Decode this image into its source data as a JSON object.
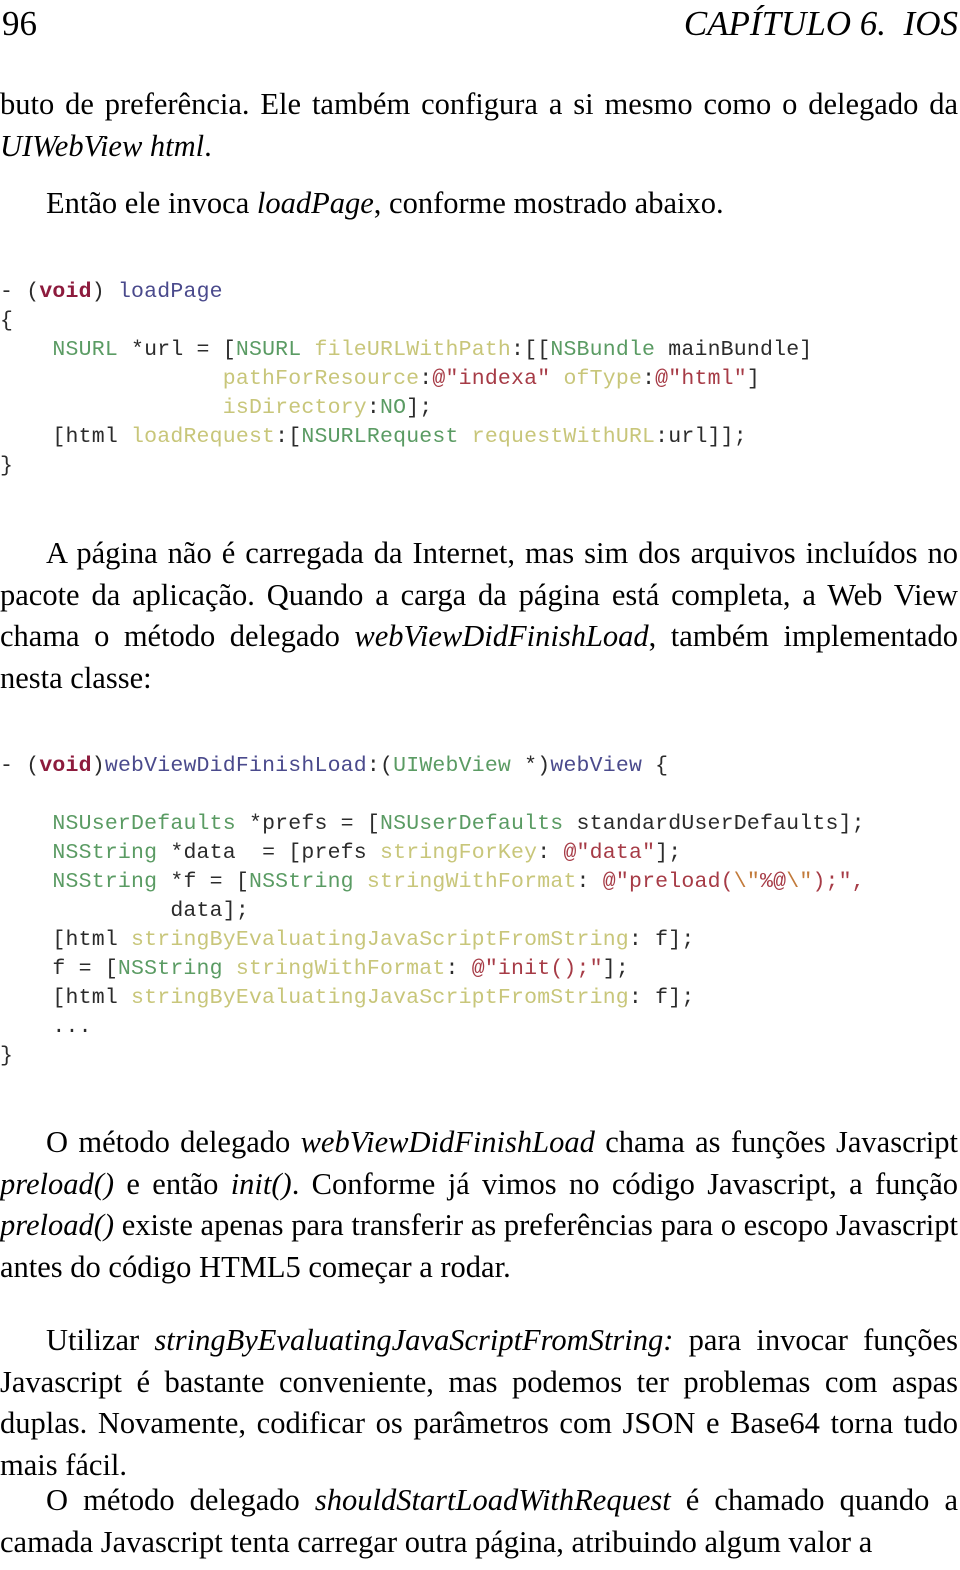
{
  "header": {
    "folio": "96",
    "chapter": "CAPÍTULO 6.  IOS"
  },
  "body": {
    "paragraph_1": {
      "line_1_a": "buto de preferência. Ele também configura a si mesmo como o delegado da ",
      "line_1_italic": "UIWebView html",
      "line_1_b": "."
    },
    "paragraph_2": {
      "a": "Então ele invoca ",
      "italic": "loadPage",
      "b": ", conforme mostrado abaixo."
    },
    "paragraph_3": {
      "a": "A página não é carregada da Internet, mas sim dos arquivos incluídos no pacote da aplicação. Quando a carga da página está completa, a Web View chama o método delegado ",
      "italic": "webViewDidFinishLoad",
      "b": ", também implementado nesta classe:"
    },
    "paragraph_4": {
      "a": "O método delegado ",
      "italic_1": "webViewDidFinishLoad",
      "b": " chama as funções Javascript ",
      "italic_2": "preload()",
      "c": " e então ",
      "italic_3": "init()",
      "d": ". Conforme já vimos no código Javascript, a função ",
      "italic_4": "preload()",
      "e": " existe apenas para transferir as preferências para o escopo Javascript antes do código HTML5 começar a rodar."
    },
    "paragraph_5": {
      "a": "Utilizar ",
      "italic": "stringByEvaluatingJavaScriptFromString:",
      "b": " para invocar funções Javascript é bastante conveniente, mas podemos ter problemas com aspas duplas. Novamente, codificar os parâmetros com JSON e Base64 torna tudo mais fácil."
    },
    "paragraph_6": {
      "a": "O método delegado ",
      "italic": "shouldStartLoadWithRequest",
      "b": " é chamado quando a camada Javascript tenta carregar outra página, atribuindo algum valor a"
    }
  },
  "code_blocks": [
    {
      "id": "loadPage",
      "lines": [
        [
          {
            "t": "- (",
            "c": "plain"
          },
          {
            "t": "void",
            "c": "type"
          },
          {
            "t": ") ",
            "c": "plain"
          },
          {
            "t": "loadPage",
            "c": "fn"
          }
        ],
        [
          {
            "t": "{",
            "c": "plain"
          }
        ],
        [
          {
            "t": "    ",
            "c": "plain"
          },
          {
            "t": "NSURL",
            "c": "class"
          },
          {
            "t": " *url = [",
            "c": "plain"
          },
          {
            "t": "NSURL",
            "c": "class"
          },
          {
            "t": " ",
            "c": "plain"
          },
          {
            "t": "fileURLWithPath",
            "c": "sel"
          },
          {
            "t": ":[[",
            "c": "plain"
          },
          {
            "t": "NSBundle",
            "c": "class"
          },
          {
            "t": " mainBundle]",
            "c": "plain"
          }
        ],
        [
          {
            "t": "                 ",
            "c": "plain"
          },
          {
            "t": "pathForResource",
            "c": "sel"
          },
          {
            "t": ":",
            "c": "plain"
          },
          {
            "t": "@\"indexa\"",
            "c": "str"
          },
          {
            "t": " ",
            "c": "plain"
          },
          {
            "t": "ofType",
            "c": "sel"
          },
          {
            "t": ":",
            "c": "plain"
          },
          {
            "t": "@\"html\"",
            "c": "str"
          },
          {
            "t": "]",
            "c": "plain"
          }
        ],
        [
          {
            "t": "                 ",
            "c": "plain"
          },
          {
            "t": "isDirectory",
            "c": "sel"
          },
          {
            "t": ":",
            "c": "plain"
          },
          {
            "t": "NO",
            "c": "class"
          },
          {
            "t": "];",
            "c": "plain"
          }
        ],
        [
          {
            "t": "    [html ",
            "c": "plain"
          },
          {
            "t": "loadRequest",
            "c": "sel"
          },
          {
            "t": ":[",
            "c": "plain"
          },
          {
            "t": "NSURLRequest",
            "c": "class"
          },
          {
            "t": " ",
            "c": "plain"
          },
          {
            "t": "requestWithURL",
            "c": "sel"
          },
          {
            "t": ":url]];",
            "c": "plain"
          }
        ],
        [
          {
            "t": "}",
            "c": "plain"
          }
        ]
      ]
    },
    {
      "id": "webViewDidFinishLoad",
      "lines": [
        [
          {
            "t": "- (",
            "c": "plain"
          },
          {
            "t": "void",
            "c": "type"
          },
          {
            "t": ")",
            "c": "plain"
          },
          {
            "t": "webViewDidFinishLoad",
            "c": "fn"
          },
          {
            "t": ":(",
            "c": "plain"
          },
          {
            "t": "UIWebView",
            "c": "class"
          },
          {
            "t": " *)",
            "c": "plain"
          },
          {
            "t": "webView",
            "c": "fn"
          },
          {
            "t": " {",
            "c": "plain"
          }
        ],
        [
          {
            "t": "",
            "c": "plain"
          }
        ],
        [
          {
            "t": "    ",
            "c": "plain"
          },
          {
            "t": "NSUserDefaults",
            "c": "class"
          },
          {
            "t": " *prefs = [",
            "c": "plain"
          },
          {
            "t": "NSUserDefaults",
            "c": "class"
          },
          {
            "t": " standardUserDefaults];",
            "c": "plain"
          }
        ],
        [
          {
            "t": "    ",
            "c": "plain"
          },
          {
            "t": "NSString",
            "c": "class"
          },
          {
            "t": " *data  = [prefs ",
            "c": "plain"
          },
          {
            "t": "stringForKey",
            "c": "sel"
          },
          {
            "t": ": ",
            "c": "plain"
          },
          {
            "t": "@\"data\"",
            "c": "str"
          },
          {
            "t": "];",
            "c": "plain"
          }
        ],
        [
          {
            "t": "    ",
            "c": "plain"
          },
          {
            "t": "NSString",
            "c": "class"
          },
          {
            "t": " *f = [",
            "c": "plain"
          },
          {
            "t": "NSString",
            "c": "class"
          },
          {
            "t": " ",
            "c": "plain"
          },
          {
            "t": "stringWithFormat",
            "c": "sel"
          },
          {
            "t": ": ",
            "c": "plain"
          },
          {
            "t": "@\"preload(",
            "c": "str"
          },
          {
            "t": "\\\"",
            "c": "esc"
          },
          {
            "t": "%@",
            "c": "str"
          },
          {
            "t": "\\\"",
            "c": "esc"
          },
          {
            "t": ");\",",
            "c": "str"
          }
        ],
        [
          {
            "t": "             data];",
            "c": "plain"
          }
        ],
        [
          {
            "t": "    [html ",
            "c": "plain"
          },
          {
            "t": "stringByEvaluatingJavaScriptFromString",
            "c": "sel"
          },
          {
            "t": ": f];",
            "c": "plain"
          }
        ],
        [
          {
            "t": "    f = [",
            "c": "plain"
          },
          {
            "t": "NSString",
            "c": "class"
          },
          {
            "t": " ",
            "c": "plain"
          },
          {
            "t": "stringWithFormat",
            "c": "sel"
          },
          {
            "t": ": ",
            "c": "plain"
          },
          {
            "t": "@\"init();\"",
            "c": "str"
          },
          {
            "t": "];",
            "c": "plain"
          }
        ],
        [
          {
            "t": "    [html ",
            "c": "plain"
          },
          {
            "t": "stringByEvaluatingJavaScriptFromString",
            "c": "sel"
          },
          {
            "t": ": f];",
            "c": "plain"
          }
        ],
        [
          {
            "t": "    ...",
            "c": "plain"
          }
        ],
        [
          {
            "t": "}",
            "c": "plain"
          }
        ]
      ]
    }
  ],
  "colors": {
    "type": "#8d1b3d",
    "function": "#4a4a8c",
    "class": "#5a9b63",
    "selector": "#c8c67a",
    "string": "#a63b46",
    "escape": "#c27a3a",
    "plain": "#2b2b2b",
    "text": "#000000",
    "background": "#ffffff"
  }
}
